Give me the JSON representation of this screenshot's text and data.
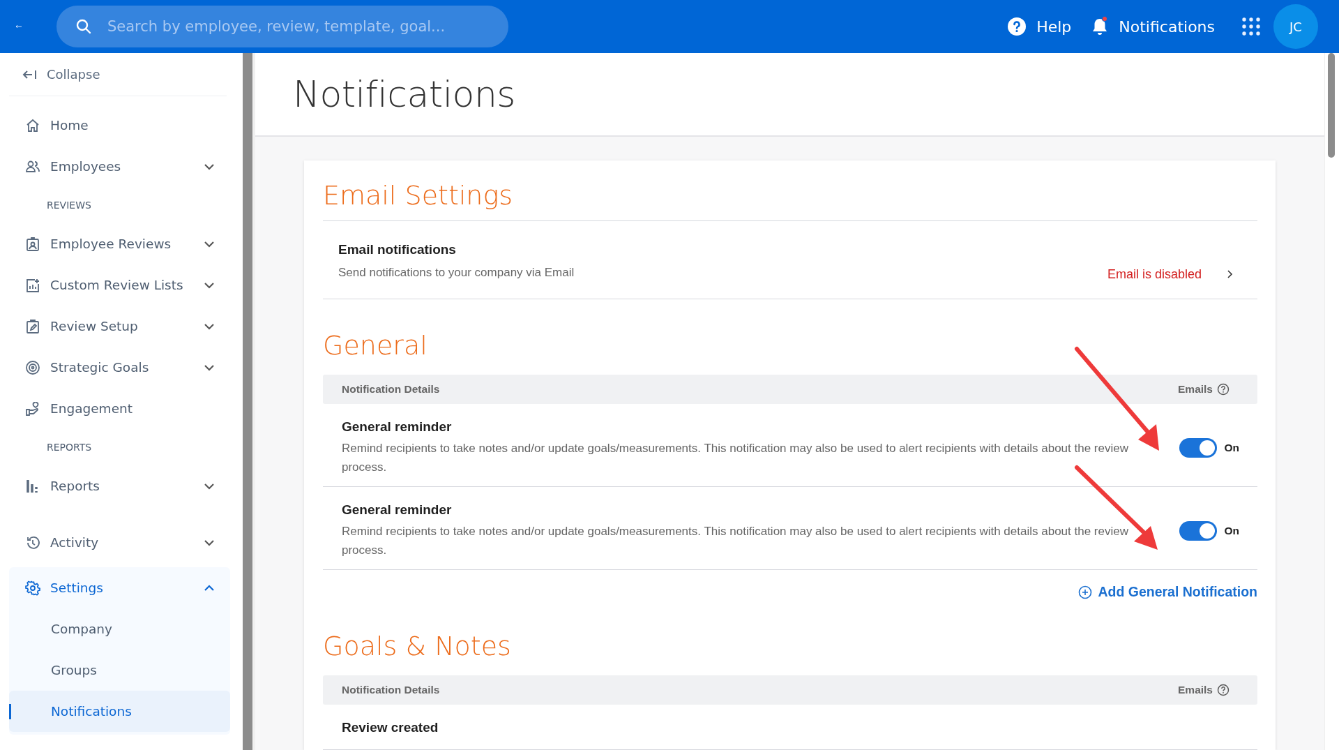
{
  "topbar": {
    "search": {
      "placeholder": "Search by employee, review, template, goal..."
    },
    "help": "Help",
    "notifications": {
      "label": "Notifications",
      "unread": true
    },
    "avatar": "JC"
  },
  "sidebar": {
    "collapse": "Collapse",
    "items": [
      {
        "kind": "link",
        "label": "Home",
        "selected": false
      },
      {
        "kind": "group",
        "label": "Employees",
        "expanded": false,
        "selected": false
      },
      {
        "kind": "section",
        "label": "REVIEWS"
      },
      {
        "kind": "group",
        "label": "Employee Reviews",
        "expanded": false,
        "selected": false
      },
      {
        "kind": "group",
        "label": "Custom Review Lists",
        "expanded": false,
        "selected": false
      },
      {
        "kind": "group",
        "label": "Review Setup",
        "expanded": false,
        "selected": false
      },
      {
        "kind": "group",
        "label": "Strategic Goals",
        "expanded": false,
        "selected": false
      },
      {
        "kind": "link",
        "label": "Engagement",
        "selected": false
      },
      {
        "kind": "section",
        "label": "REPORTS"
      },
      {
        "kind": "group",
        "label": "Reports",
        "expanded": false,
        "selected": false
      },
      {
        "kind": "group",
        "label": "Activity",
        "expanded": false,
        "selected": false
      },
      {
        "kind": "group",
        "label": "Settings",
        "expanded": true,
        "selected": true,
        "children": [
          {
            "label": "Company",
            "selected": false
          },
          {
            "label": "Groups",
            "selected": false
          },
          {
            "label": "Notifications",
            "selected": true
          }
        ]
      }
    ]
  },
  "page": {
    "title": "Notifications",
    "sections": [
      {
        "kind": "email",
        "heading": "Email Settings",
        "rows": [
          {
            "title": "Email notifications",
            "description": "Send notifications to your company via Email",
            "status": "Email is disabled"
          }
        ]
      },
      {
        "kind": "table",
        "heading": "General",
        "columns": [
          "Notification Details",
          "Emails"
        ],
        "rows": [
          {
            "title": "General reminder",
            "description": "Remind recipients to take notes and/or update goals/measurements. This notification may also be used to alert recipients with details about the review process.",
            "on": true,
            "state_label": "On"
          },
          {
            "title": "General reminder",
            "description": "Remind recipients to take notes and/or update goals/measurements. This notification may also be used to alert recipients with details about the review process.",
            "on": true,
            "state_label": "On"
          }
        ],
        "add_action": "Add General Notification"
      },
      {
        "kind": "table",
        "heading": "Goals & Notes",
        "columns": [
          "Notification Details",
          "Emails"
        ],
        "rows": [
          {
            "title": "Review created"
          }
        ]
      }
    ]
  }
}
